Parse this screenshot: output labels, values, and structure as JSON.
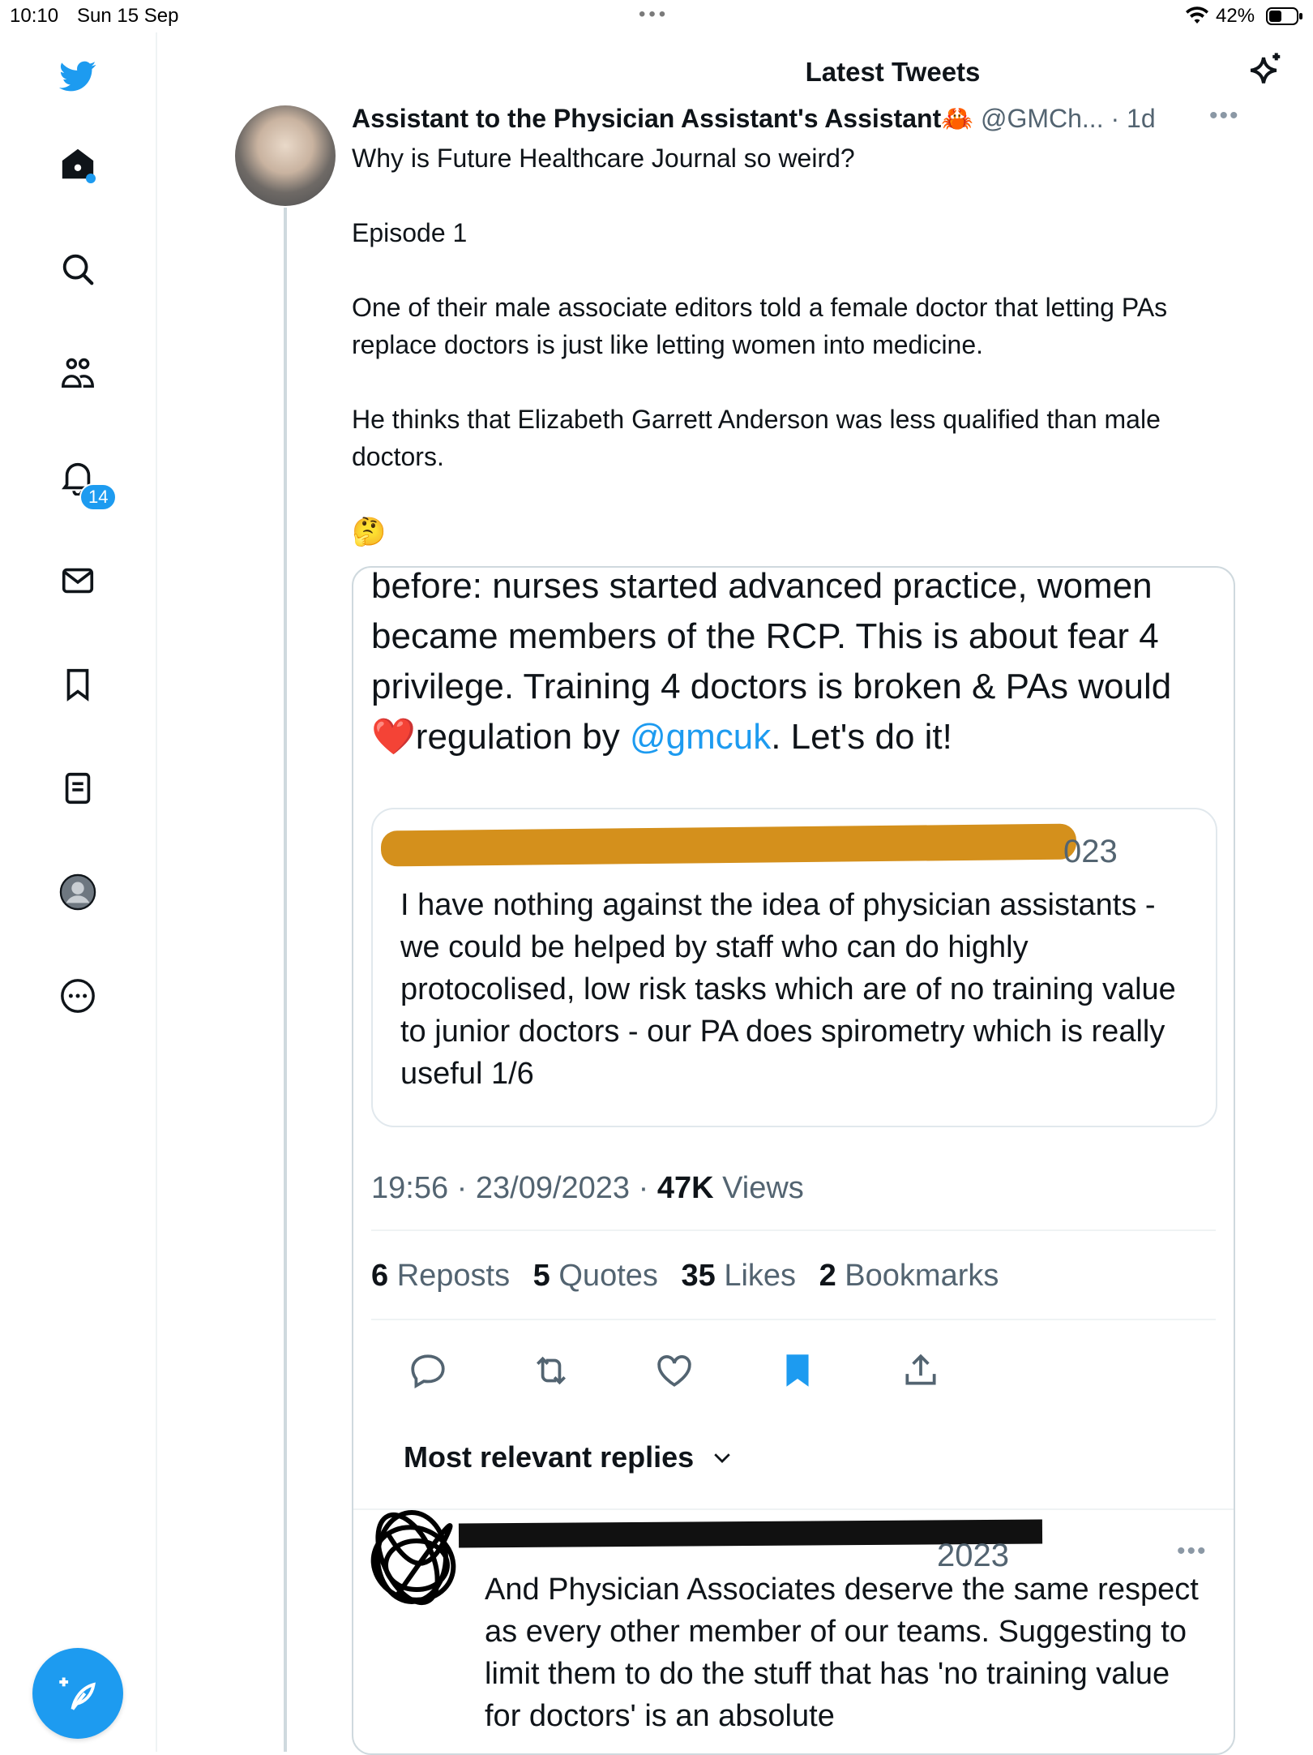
{
  "status_bar": {
    "time": "10:10",
    "date": "Sun 15 Sep",
    "battery": "42%"
  },
  "header": {
    "title": "Latest Tweets"
  },
  "sidebar": {
    "notification_count": "14"
  },
  "tweet": {
    "author_name": "Assistant to the Physician Assistant's Assistant🦀",
    "author_handle": "@GMCh... · 1d",
    "paragraphs": [
      "Why is Future Healthcare Journal so weird?",
      "Episode 1",
      "One of their male associate editors told a female doctor that letting PAs replace doctors is just like letting women into medicine.",
      "He thinks that Elizabeth Garrett Anderson was less qualified than male doctors."
    ],
    "emoji": "🤔"
  },
  "embed": {
    "text_before_mention": "before: nurses started advanced practice, women became members of the RCP. This is about fear 4 privilege. Training 4 doctors is broken & PAs would ",
    "heart": "❤️",
    "text_regulation": "regulation by ",
    "mention": "@gmcuk",
    "text_after_mention": ". Let's do it!",
    "quoted": {
      "date_fragment": "023",
      "text": "I have nothing against the idea of physician assistants - we could be helped by staff who can  do highly protocolised, low risk tasks which are of no training value to junior doctors - our PA does spirometry which is really useful 1/6"
    },
    "meta_time": "19:56 · 23/09/2023 · ",
    "views_count": "47K",
    "views_label": "Views",
    "stats": {
      "reposts_count": "6",
      "reposts_label": "Reposts",
      "quotes_count": "5",
      "quotes_label": "Quotes",
      "likes_count": "35",
      "likes_label": "Likes",
      "bookmarks_count": "2",
      "bookmarks_label": "Bookmarks"
    },
    "sort_label": "Most relevant replies",
    "reply": {
      "date_fragment": "2023",
      "text": "And Physician Associates deserve the same respect as every other member of our teams. Suggesting to limit them to do the stuff that has 'no training value for doctors' is an absolute"
    }
  },
  "colors": {
    "accent": "#1d9bf0",
    "redaction_orange": "#d4901c",
    "like_red": "#e0245e"
  }
}
